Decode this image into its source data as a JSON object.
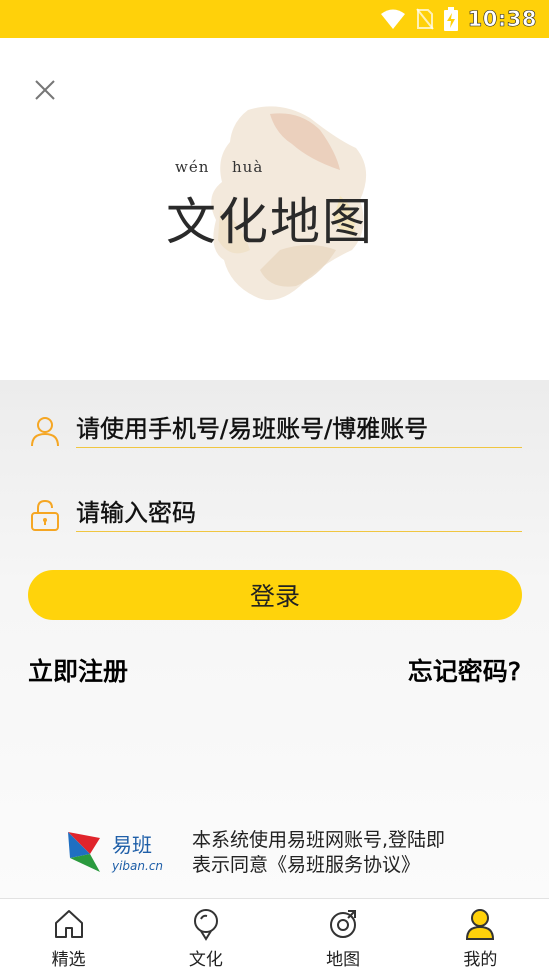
{
  "status_bar": {
    "time": "10:38"
  },
  "header": {
    "logo": {
      "pinyin_wen": "wén",
      "pinyin_hua": "huà",
      "title": "文化地图"
    }
  },
  "login_form": {
    "username_placeholder": "请使用手机号/易班账号/博雅账号",
    "password_placeholder": "请输入密码",
    "login_button": "登录",
    "register_link": "立即注册",
    "forgot_link": "忘记密码?"
  },
  "footer": {
    "yiban_brand": "易班",
    "yiban_domain": "yiban.cn",
    "agreement_line1": "本系统使用易班网账号,登陆即",
    "agreement_line2": "表示同意《易班服务协议》"
  },
  "bottom_nav": {
    "items": [
      {
        "label": "精选",
        "icon": "home-icon"
      },
      {
        "label": "文化",
        "icon": "location-pin-icon"
      },
      {
        "label": "地图",
        "icon": "compass-icon"
      },
      {
        "label": "我的",
        "icon": "user-icon",
        "active": true
      }
    ]
  },
  "colors": {
    "accent": "#ffd10a",
    "field_underline": "#f0c640",
    "icon_orange": "#f5a623"
  }
}
